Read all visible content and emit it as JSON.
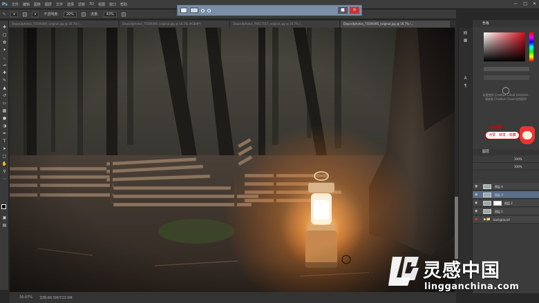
{
  "menubar": {
    "app_logo": "Ps",
    "items": [
      "文件",
      "编辑",
      "图像",
      "图层",
      "文字",
      "选择",
      "滤镜",
      "3D",
      "视图",
      "窗口",
      "帮助"
    ]
  },
  "options_bar": {
    "tool_label": "⚲",
    "opacity_label": "不透明度:",
    "opacity_value": "20%",
    "flow_label": "流量:",
    "flow_value": "43%"
  },
  "tabs": [
    {
      "label": "Depositphotos_75509395_original.jpg @ 16.7% (...",
      "active": false
    },
    {
      "label": "Depositphotos_75509395_original.jpg @ 16.7% (RGB/8*)",
      "active": false
    },
    {
      "label": "Depositphotos_96617157_original.jpg @ 16.7% (...",
      "active": false
    },
    {
      "label": "Depositphotos_75509395_original.jpg @ 16.7% (...",
      "active": true
    }
  ],
  "status": {
    "zoom": "16.67%",
    "doc": "文档:66.5M/723.0M"
  },
  "right_panel": {
    "swatches_tab": "色板",
    "libraries_text": "库",
    "cc_line1": "若要使用 Creative Cloud Libraries,",
    "cc_line2": "请安装 Creative Cloud 应用程序",
    "promo_top": "小孩说明!",
    "promo_text": "点赞 · 转发 · 收藏",
    "layers_tab": "图层",
    "opacity": "100%",
    "fill": "100%",
    "layers": [
      {
        "name": "图层 4",
        "selected": false,
        "type": "layer"
      },
      {
        "name": "图层 3",
        "selected": true,
        "type": "layer"
      },
      {
        "name": "图层 2",
        "selected": false,
        "type": "masked"
      },
      {
        "name": "图层 1",
        "selected": false,
        "type": "layer"
      },
      {
        "name": "background",
        "selected": false,
        "type": "folder"
      }
    ]
  },
  "watermark": {
    "cn": "灵感中国",
    "url": "lingganchina.com"
  },
  "colors": {
    "accent_selected": "#5a6e88",
    "lamp_glow": "#ffb060",
    "brand_red": "#d00000"
  }
}
